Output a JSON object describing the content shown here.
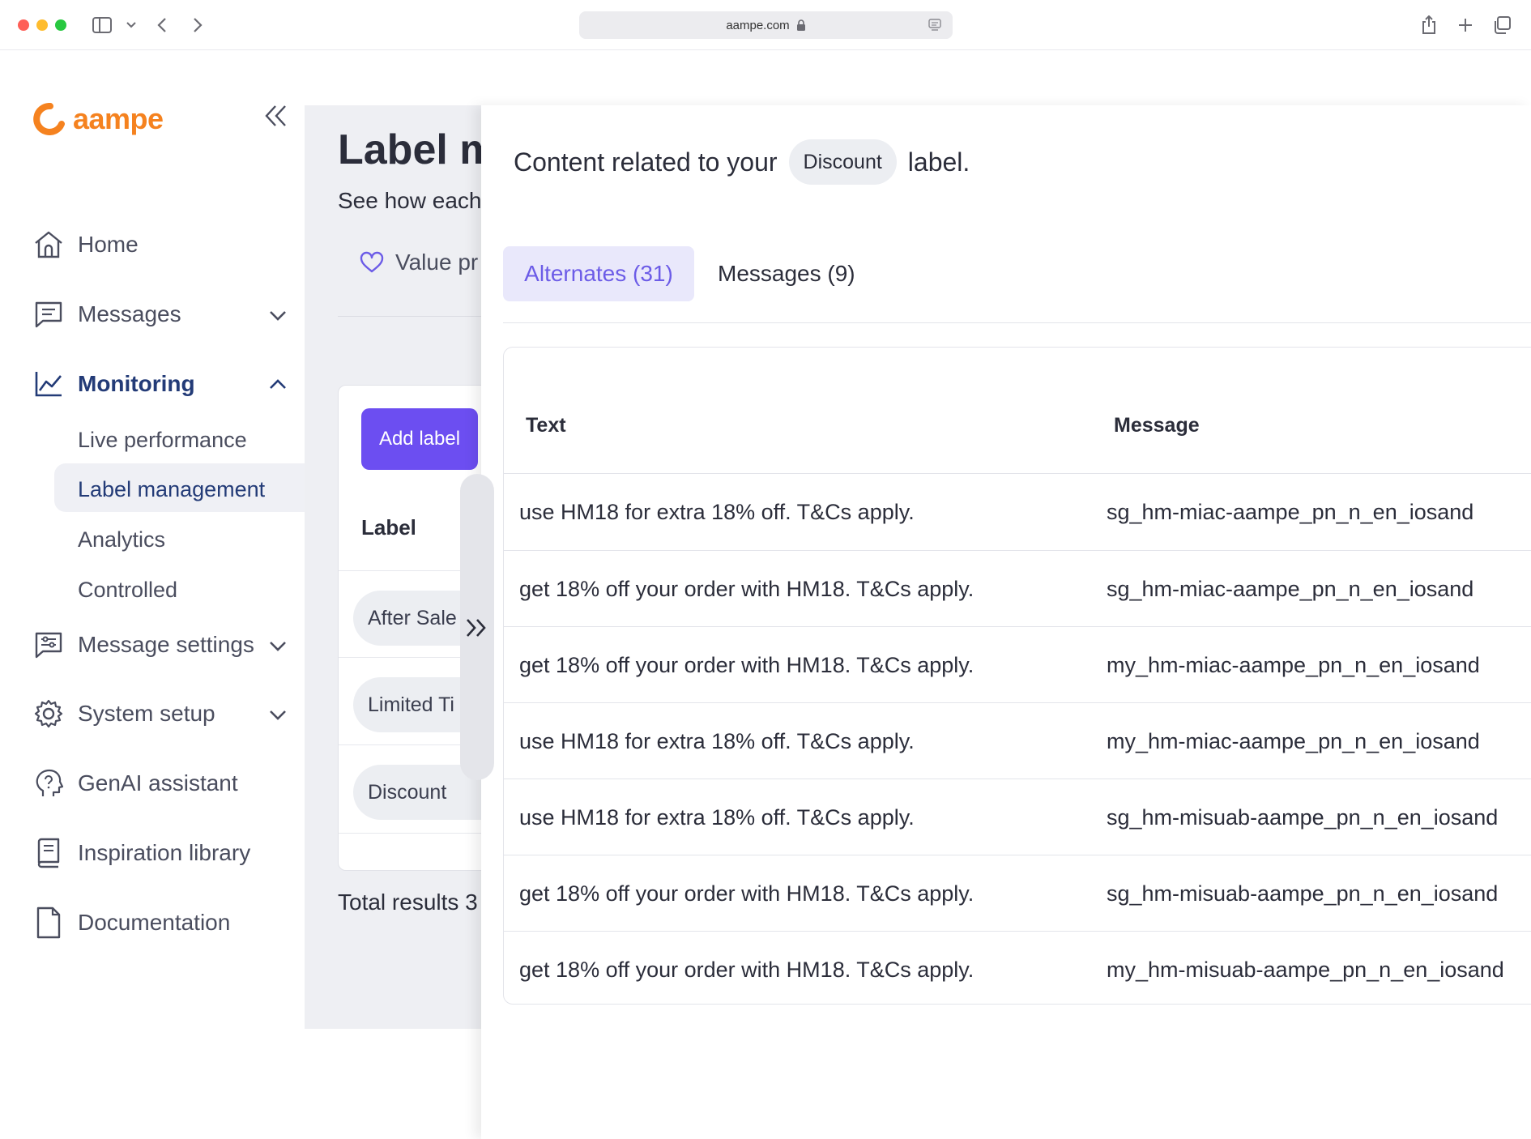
{
  "browser": {
    "url": "aampe.com"
  },
  "sidebar": {
    "logo": "aampe",
    "nav": {
      "home": "Home",
      "messages": "Messages",
      "monitoring": "Monitoring",
      "message_settings": "Message settings",
      "system_setup": "System setup",
      "genai": "GenAI assistant",
      "inspiration": "Inspiration library",
      "documentation": "Documentation"
    },
    "monitoring_sub": {
      "live": "Live performance",
      "label_mgmt": "Label management",
      "analytics": "Analytics",
      "controlled": "Controlled"
    }
  },
  "main": {
    "title": "Label m",
    "subtitle": "See how each",
    "value_tab": "Value pr",
    "add_label": "Add label",
    "label_col": "Label",
    "labels": [
      "After Sale",
      "Limited Ti",
      "Discount"
    ],
    "total": "Total results 3"
  },
  "panel": {
    "title_prefix": "Content related to your",
    "title_label": "Discount",
    "title_suffix": "label.",
    "tabs": {
      "alternates": "Alternates (31)",
      "messages": "Messages (9)"
    },
    "columns": {
      "text": "Text",
      "message": "Message"
    },
    "rows": [
      {
        "text": "use HM18 for extra 18% off. T&Cs apply.",
        "message": "sg_hm-miac-aampe_pn_n_en_iosand"
      },
      {
        "text": "get 18% off your order with HM18. T&Cs apply.",
        "message": "sg_hm-miac-aampe_pn_n_en_iosand"
      },
      {
        "text": "get 18% off your order with HM18. T&Cs apply.",
        "message": "my_hm-miac-aampe_pn_n_en_iosand"
      },
      {
        "text": "use HM18 for extra 18% off. T&Cs apply.",
        "message": "my_hm-miac-aampe_pn_n_en_iosand"
      },
      {
        "text": "use HM18 for extra 18% off. T&Cs apply.",
        "message": "sg_hm-misuab-aampe_pn_n_en_iosand"
      },
      {
        "text": "get 18% off your order with HM18. T&Cs apply.",
        "message": "sg_hm-misuab-aampe_pn_n_en_iosand"
      },
      {
        "text": "get 18% off your order with HM18. T&Cs apply.",
        "message": "my_hm-misuab-aampe_pn_n_en_iosand"
      }
    ]
  },
  "colors": {
    "accent": "#6c4ef1",
    "brand": "#f5821f",
    "active_nav": "#233b77",
    "tab_active_bg": "#e9e8fb"
  }
}
